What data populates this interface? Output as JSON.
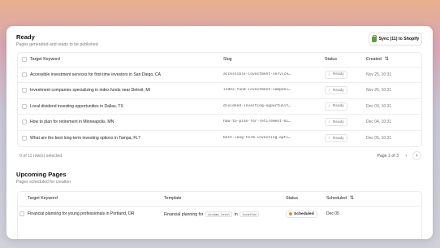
{
  "ready": {
    "title": "Ready",
    "subtitle": "Pages generated and ready to be published",
    "sync_label": "Sync (11) to Shopify",
    "columns": {
      "keyword": "Target Keyword",
      "slug": "Slug",
      "status": "Status",
      "created": "Created"
    },
    "rows": [
      {
        "keyword": "Accessible investment services for first-time investors in San Diego, CA",
        "slug": "accessible-investment-services-for",
        "status": "Ready",
        "created": "Nov 25, 10:31"
      },
      {
        "keyword": "Investment companies specializing in index funds near Detroit, MI",
        "slug": "index-fund-investment-companies-de",
        "status": "Ready",
        "created": "Nov 26, 10:31"
      },
      {
        "keyword": "Local dividend investing opportunities in Dallas, TX",
        "slug": "dividend-investing-opportunities-d",
        "status": "Ready",
        "created": "Dec 03, 10:31"
      },
      {
        "keyword": "How to plan for retirement in Minneapolis, MN",
        "slug": "how-to-plan-for-retirement-minneap",
        "status": "Ready",
        "created": "Dec 04, 10:31"
      },
      {
        "keyword": "What are the best long-term investing options in Tampa, FL?",
        "slug": "best-long-term-investing-options-t",
        "status": "Ready",
        "created": "Dec 05, 10:31"
      }
    ],
    "selection_text": "0 of 11 row(s) selected.",
    "page_text": "Page 1 of 3"
  },
  "upcoming": {
    "title": "Upcoming Pages",
    "subtitle": "Pages scheduled for creation",
    "columns": {
      "keyword": "Target Keyword",
      "template": "Template",
      "status": "Status",
      "scheduled": "Scheduled"
    },
    "rows": [
      {
        "keyword": "Financial planning for young professionals in Portland, OR",
        "template_prefix": "Financial planning for",
        "chip1": "income_level",
        "template_mid": "in",
        "chip2": "location",
        "status": "Scheduled",
        "scheduled": "Dec 05"
      }
    ]
  },
  "colors": {
    "accent_scheduled": "#f08a2c",
    "shopify_green": "#5e9e3a"
  }
}
